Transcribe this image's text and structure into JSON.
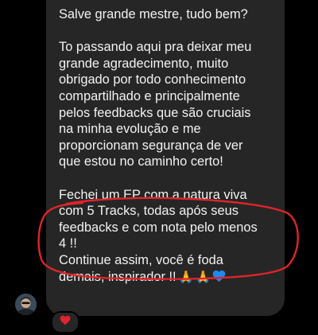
{
  "message": {
    "greeting": "Salve grande mestre, tudo bem?",
    "thanks_lines": [
      "To passando aqui pra deixar meu",
      "grande agradecimento, muito",
      "obrigado por todo conhecimento",
      "compartilhado e principalmente",
      "pelos feedbacks que são cruciais",
      "na minha evolução e me",
      "proporcionam segurança de ver",
      "que estou no caminho certo!"
    ],
    "ep_lines": [
      "Fechei um EP com a natura viva",
      "com 5 Tracks, todas após seus",
      "feedbacks e com nota pelo menos",
      "4 !!"
    ],
    "closing_line_1": "Continue assim, você é foda",
    "closing_line_2": "demais, inspirador !!",
    "closing_emojis": [
      "folded-hands",
      "folded-hands",
      "blue-heart"
    ]
  },
  "reaction": {
    "emoji": "red-heart",
    "color": "#e0242b"
  },
  "highlight": {
    "color": "#e0242b"
  },
  "colors": {
    "background": "#000000",
    "bubble": "#262626",
    "text": "#f2f2f2",
    "blue_heart": "#1d8cf0"
  }
}
